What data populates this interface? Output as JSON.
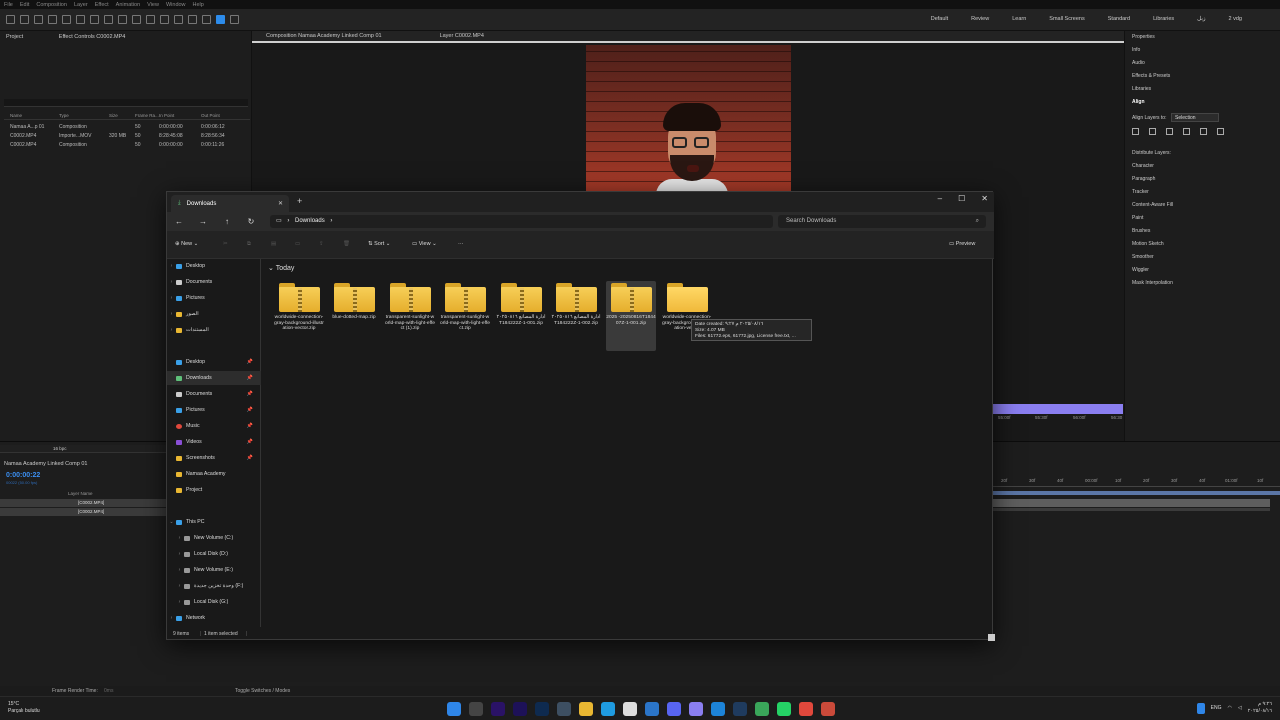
{
  "ae": {
    "menu": [
      "File",
      "Edit",
      "Composition",
      "Layer",
      "Effect",
      "Animation",
      "View",
      "Window",
      "Help"
    ],
    "workspaces": [
      "Default",
      "Review",
      "Learn",
      "Small Screens",
      "Standard",
      "Libraries",
      "زبل",
      "2 vdg"
    ],
    "project": {
      "tab_project": "Project",
      "tab_effects": "Effect Controls C0002.MP4",
      "columns": [
        "Name",
        "Type",
        "Size",
        "Frame Ra...",
        "In Point",
        "Out Point"
      ],
      "rows": [
        {
          "name": "Namaa A...p 01",
          "type": "Composition",
          "size": "",
          "fps": "50",
          "in": "0:00:00:00",
          "out": "0:00:06:12"
        },
        {
          "name": "C0002.MP4",
          "type": "Importe...MOV",
          "size": "320 MB",
          "fps": "50",
          "in": "8:28:45:08",
          "out": "8:28:56:34"
        },
        {
          "name": "C0002.MP4",
          "type": "Composition",
          "size": "",
          "fps": "50",
          "in": "0:00:00:00",
          "out": "0:00:11:26"
        }
      ]
    },
    "viewer_tabs": {
      "comp": "Composition Namaa Academy Linked Comp 01",
      "layer": "Layer C0002.MP4"
    },
    "right_panels": {
      "top": [
        "Properties",
        "Info",
        "Audio",
        "Effects & Presets",
        "Libraries"
      ],
      "align": "Align",
      "align_to_label": "Align Layers to:",
      "align_to_value": "Selection",
      "distribute": "Distribute Layers:",
      "rest": [
        "Character",
        "Paragraph",
        "Tracker",
        "Content-Aware Fill",
        "Paint",
        "Brushes",
        "Motion Sketch",
        "Smoother",
        "Wiggler",
        "Mask Interpolation"
      ]
    },
    "timeline": {
      "bit_depth": "16 bpc",
      "tab": "Namaa Academy Linked Comp 01",
      "time": "0:00:00:22",
      "fps_note": "00022 (50.00 fps)",
      "col_layer": "Layer Name",
      "layers": [
        "[C0002.MP4]",
        "[C0002.MP4]"
      ],
      "ruler": [
        "20f",
        "30f",
        "40f",
        "00:00f",
        "10f",
        "20f",
        "30f",
        "40f",
        "01:00f",
        "10f"
      ],
      "ruler_upper": [
        "55:00f",
        "55:30f",
        "56:00f",
        "56:30"
      ]
    },
    "status": {
      "render": "Frame Render Time:",
      "render_val": "0ms",
      "toggle": "Toggle Switches / Modes"
    }
  },
  "explorer": {
    "tab_title": "Downloads",
    "address": [
      "Downloads"
    ],
    "search_placeholder": "Search Downloads",
    "commands": {
      "new": "New",
      "sort": "Sort",
      "view": "View",
      "more": "···",
      "preview": "Preview"
    },
    "nav_top": [
      "Desktop",
      "Documents",
      "Pictures",
      "الصور",
      "المستندات"
    ],
    "nav_pinned": [
      "Desktop",
      "Downloads",
      "Documents",
      "Pictures",
      "Music",
      "Videos",
      "Screenshots",
      "Namaa Academy",
      "Project"
    ],
    "this_pc": "This PC",
    "drives": [
      "New Volume (C:)",
      "Local Disk (D:)",
      "New Volume (E:)",
      "وحدة تخزين جديدة (F:)",
      "Local Disk (G:)"
    ],
    "network": "Network",
    "group": "Today",
    "files": [
      {
        "name": "worldwide-connection-gray-background-illustration-vector.zip",
        "zip": true
      },
      {
        "name": "blue-dotted-map.zip",
        "zip": true
      },
      {
        "name": "transparent-sunlight-world-map-with-light-effect (1).zip",
        "zip": true
      },
      {
        "name": "transparent-sunlight-world-map-with-light-effect.zip",
        "zip": true
      },
      {
        "name": "ادارة المصانع ٢٠٢٥٠٨١٦T184222Z-1-001.zip",
        "zip": true
      },
      {
        "name": "ادارة المصانع ٢٠٢٥٠٨١٦T184222Z-1-002.zip",
        "zip": true
      },
      {
        "name": "2025 -20250816T184407Z-1-001.zip",
        "zip": true,
        "selected": true
      },
      {
        "name": "worldwide-connection-gray-background-illustration-vector",
        "zip": false
      }
    ],
    "tooltip": {
      "created": "Date created: ٢٠٢٥/٠٨/١٦ م ٩:٢٧",
      "size": "Size: 4.07 MB",
      "files": "Files: 61772.eps, 61772.jpg, License free.txt, ..."
    },
    "status": {
      "items": "9 items",
      "selected": "1 item selected"
    }
  },
  "taskbar": {
    "temp": "15°C",
    "weather": "Parçalı bulutlu",
    "lang": "ENG",
    "time": "٩:٢٦ م",
    "date": "٢٠٢٥/٠٨/١٦"
  }
}
